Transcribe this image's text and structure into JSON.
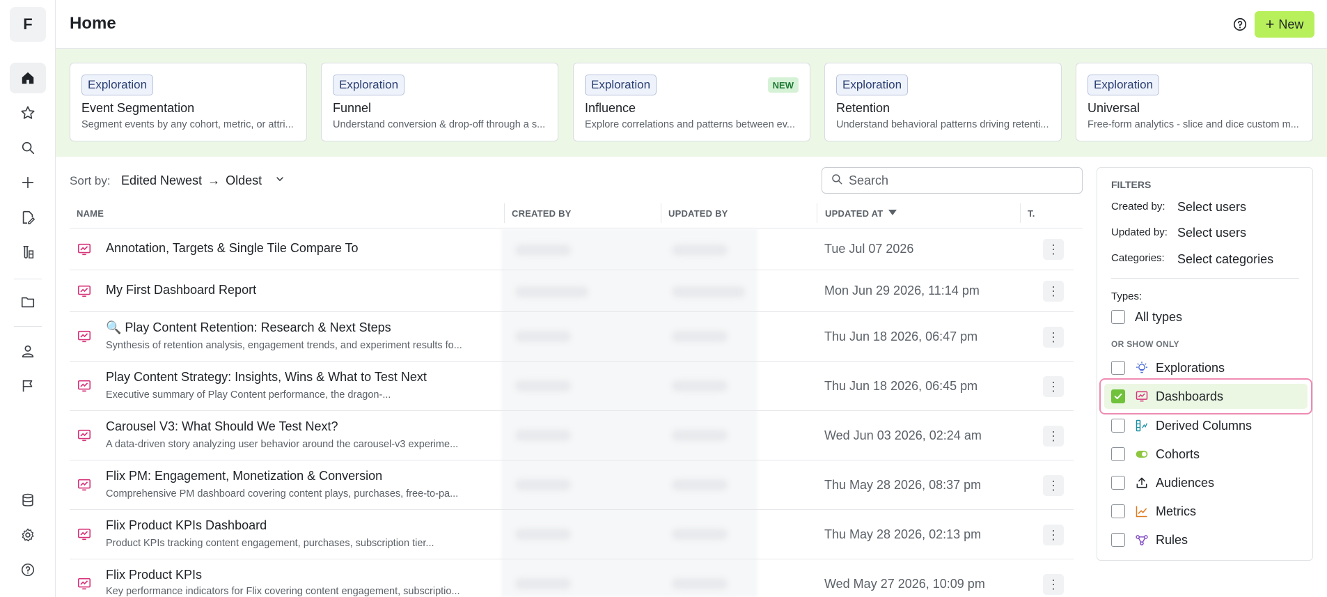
{
  "sidebar": {
    "logo": "F",
    "items": [
      {
        "name": "home",
        "icon": "home-icon"
      },
      {
        "name": "favorites",
        "icon": "star-icon"
      },
      {
        "name": "search",
        "icon": "search-icon"
      },
      {
        "name": "create",
        "icon": "plus-icon"
      },
      {
        "name": "notes",
        "icon": "document-edit-icon"
      },
      {
        "name": "experiments",
        "icon": "flask-icon"
      },
      {
        "name": "folders",
        "icon": "folder-icon"
      },
      {
        "name": "users",
        "icon": "user-icon"
      },
      {
        "name": "flags",
        "icon": "flag-icon"
      },
      {
        "name": "data",
        "icon": "database-icon"
      },
      {
        "name": "settings",
        "icon": "gear-icon"
      },
      {
        "name": "help",
        "icon": "help-icon"
      }
    ]
  },
  "header": {
    "title": "Home",
    "new_label": "New"
  },
  "templates": [
    {
      "tag": "Exploration",
      "title": "Event Segmentation",
      "desc": "Segment events by any cohort, metric, or attri...",
      "badge": ""
    },
    {
      "tag": "Exploration",
      "title": "Funnel",
      "desc": "Understand conversion & drop-off through a s...",
      "badge": ""
    },
    {
      "tag": "Exploration",
      "title": "Influence",
      "desc": "Explore correlations and patterns between ev...",
      "badge": "NEW"
    },
    {
      "tag": "Exploration",
      "title": "Retention",
      "desc": "Understand behavioral patterns driving retenti...",
      "badge": ""
    },
    {
      "tag": "Exploration",
      "title": "Universal",
      "desc": "Free-form analytics - slice and dice custom m...",
      "badge": ""
    }
  ],
  "sort": {
    "label": "Sort by:",
    "value_from": "Edited Newest",
    "value_to": "Oldest"
  },
  "search": {
    "placeholder": "Search"
  },
  "table": {
    "columns": [
      "NAME",
      "CREATED BY",
      "UPDATED BY",
      "UPDATED AT",
      "T."
    ],
    "rows": [
      {
        "title": "Annotation, Targets & Single Tile Compare To",
        "desc": "",
        "date": "Tue Jul 07 2026"
      },
      {
        "title": "My First Dashboard Report",
        "desc": "",
        "date": "Mon Jun 29 2026, 11:14 pm"
      },
      {
        "title": "🔍 Play Content Retention: Research & Next Steps",
        "desc": "Synthesis of retention analysis, engagement trends, and experiment results fo...",
        "date": "Thu Jun 18 2026, 06:47 pm"
      },
      {
        "title": "Play Content Strategy: Insights, Wins & What to Test Next",
        "desc": "Executive summary of Play Content performance, the dragon-...",
        "date": "Thu Jun 18 2026, 06:45 pm"
      },
      {
        "title": "Carousel V3: What Should We Test Next?",
        "desc": "A data-driven story analyzing user behavior around the carousel-v3 experime...",
        "date": "Wed Jun 03 2026, 02:24 am"
      },
      {
        "title": "Flix PM: Engagement, Monetization & Conversion",
        "desc": "Comprehensive PM dashboard covering content plays, purchases, free-to-pa...",
        "date": "Thu May 28 2026, 08:37 pm"
      },
      {
        "title": "Flix Product KPIs Dashboard",
        "desc": "Product KPIs tracking content engagement, purchases, subscription tier...",
        "date": "Thu May 28 2026, 02:13 pm"
      },
      {
        "title": "Flix Product KPIs",
        "desc": "Key performance indicators for Flix covering content engagement, subscriptio...",
        "date": "Wed May 27 2026, 10:09 pm"
      }
    ]
  },
  "filters": {
    "title": "FILTERS",
    "created_by_label": "Created by:",
    "created_by_value": "Select users",
    "updated_by_label": "Updated by:",
    "updated_by_value": "Select users",
    "categories_label": "Categories:",
    "categories_value": "Select categories",
    "types_label": "Types:",
    "all_types_label": "All types",
    "or_show_only": "OR SHOW ONLY",
    "options": [
      {
        "label": "Explorations",
        "checked": false,
        "icon": "lightbulb-icon"
      },
      {
        "label": "Dashboards",
        "checked": true,
        "icon": "dashboard-icon"
      },
      {
        "label": "Derived Columns",
        "checked": false,
        "icon": "derived-column-icon"
      },
      {
        "label": "Cohorts",
        "checked": false,
        "icon": "cohort-icon"
      },
      {
        "label": "Audiences",
        "checked": false,
        "icon": "upload-icon"
      },
      {
        "label": "Metrics",
        "checked": false,
        "icon": "chart-line-icon"
      },
      {
        "label": "Rules",
        "checked": false,
        "icon": "rules-icon"
      }
    ]
  },
  "colors": {
    "accent_green": "#b7f05a",
    "dashboard_pink": "#d6337a",
    "checked_green": "#6fc23a",
    "highlight_border": "#ef8bb2"
  }
}
